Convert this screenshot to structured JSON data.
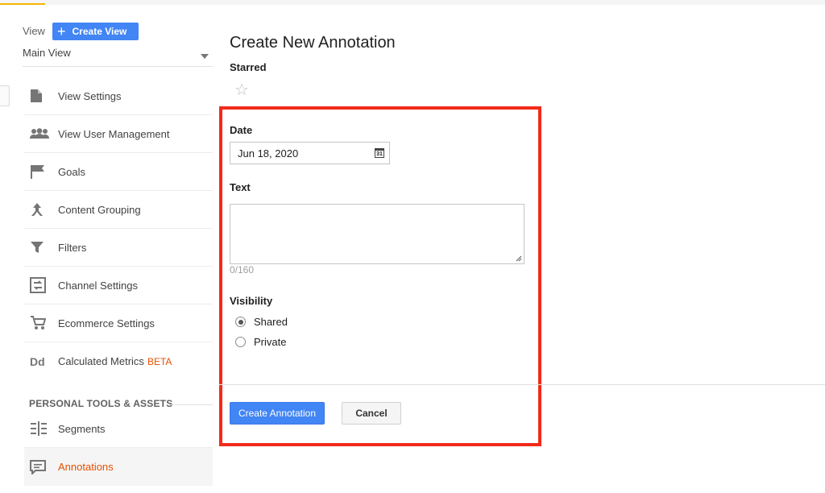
{
  "sidebar": {
    "view_label": "View",
    "create_view_label": "Create View",
    "selected_view": "Main View",
    "items": [
      {
        "label": "View Settings",
        "icon": "document-icon"
      },
      {
        "label": "View User Management",
        "icon": "users-icon"
      },
      {
        "label": "Goals",
        "icon": "flag-icon"
      },
      {
        "label": "Content Grouping",
        "icon": "grouping-icon"
      },
      {
        "label": "Filters",
        "icon": "filter-icon"
      },
      {
        "label": "Channel Settings",
        "icon": "channel-settings-icon"
      },
      {
        "label": "Ecommerce Settings",
        "icon": "cart-icon"
      },
      {
        "label": "Calculated Metrics",
        "badge": "BETA",
        "icon": "dd-icon",
        "icon_text": "Dd"
      }
    ],
    "personal_section": {
      "title": "PERSONAL TOOLS & ASSETS",
      "items": [
        {
          "label": "Segments",
          "icon": "segments-icon"
        },
        {
          "label": "Annotations",
          "icon": "annotations-icon",
          "active": true
        }
      ]
    }
  },
  "form": {
    "title": "Create New Annotation",
    "starred_label": "Starred",
    "star_icon": "star-outline-icon",
    "date_label": "Date",
    "date_value": "Jun 18, 2020",
    "calendar_icon_text": "31",
    "text_label": "Text",
    "text_value": "",
    "char_counter": "0/160",
    "visibility_label": "Visibility",
    "visibility_options": [
      {
        "label": "Shared",
        "checked": true
      },
      {
        "label": "Private",
        "checked": false
      }
    ],
    "create_button": "Create Annotation",
    "cancel_button": "Cancel"
  },
  "colors": {
    "accent_blue": "#4285f4",
    "active_orange": "#e65100",
    "highlight_red": "#f22b1b"
  }
}
